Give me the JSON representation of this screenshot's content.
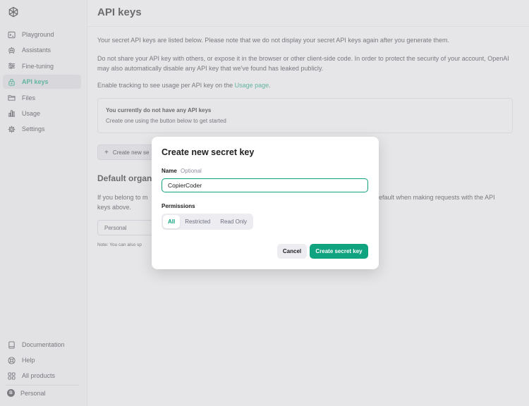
{
  "colors": {
    "accent": "#10a37f",
    "sidebar_bg": "#f7f7f8",
    "overlay": "rgba(200,200,204,0.45)"
  },
  "sidebar": {
    "logo": "openai-logo",
    "items": [
      {
        "label": "Playground",
        "icon": "terminal-icon"
      },
      {
        "label": "Assistants",
        "icon": "robot-icon"
      },
      {
        "label": "Fine-tuning",
        "icon": "sliders-icon"
      },
      {
        "label": "API keys",
        "icon": "lock-icon",
        "active": true
      },
      {
        "label": "Files",
        "icon": "folder-icon"
      },
      {
        "label": "Usage",
        "icon": "bar-chart-icon"
      },
      {
        "label": "Settings",
        "icon": "gear-icon"
      }
    ],
    "bottom_items": [
      {
        "label": "Documentation",
        "icon": "book-icon"
      },
      {
        "label": "Help",
        "icon": "help-icon"
      },
      {
        "label": "All products",
        "icon": "grid-icon"
      }
    ],
    "account": {
      "initial": "B",
      "label": "Personal"
    }
  },
  "main": {
    "title": "API keys",
    "intro": "Your secret API keys are listed below. Please note that we do not display your secret API keys again after you generate them.",
    "warning": "Do not share your API key with others, or expose it in the browser or other client-side code. In order to protect the security of your account, OpenAI may also automatically disable any API key that we've found has leaked publicly.",
    "tracking_prefix": "Enable tracking to see usage per API key on the ",
    "tracking_link": "Usage page",
    "tracking_suffix": ".",
    "empty_title": "You currently do not have any API keys",
    "empty_subtitle": "Create one using the button below to get started",
    "create_button": "Create new se",
    "default_org_title": "Default organ",
    "default_org_text_left": "If you belong to m",
    "default_org_text_left2": "keys above.",
    "default_org_text_right": "efault when making requests with the API",
    "org_select_value": "Personal",
    "note": "Note: You can also sp"
  },
  "modal": {
    "title": "Create new secret key",
    "name_label": "Name",
    "name_optional": "Optional",
    "name_value": "CopierCoder",
    "permissions_label": "Permissions",
    "permissions": [
      "All",
      "Restricted",
      "Read Only"
    ],
    "permissions_selected": "All",
    "cancel": "Cancel",
    "submit": "Create secret key"
  }
}
